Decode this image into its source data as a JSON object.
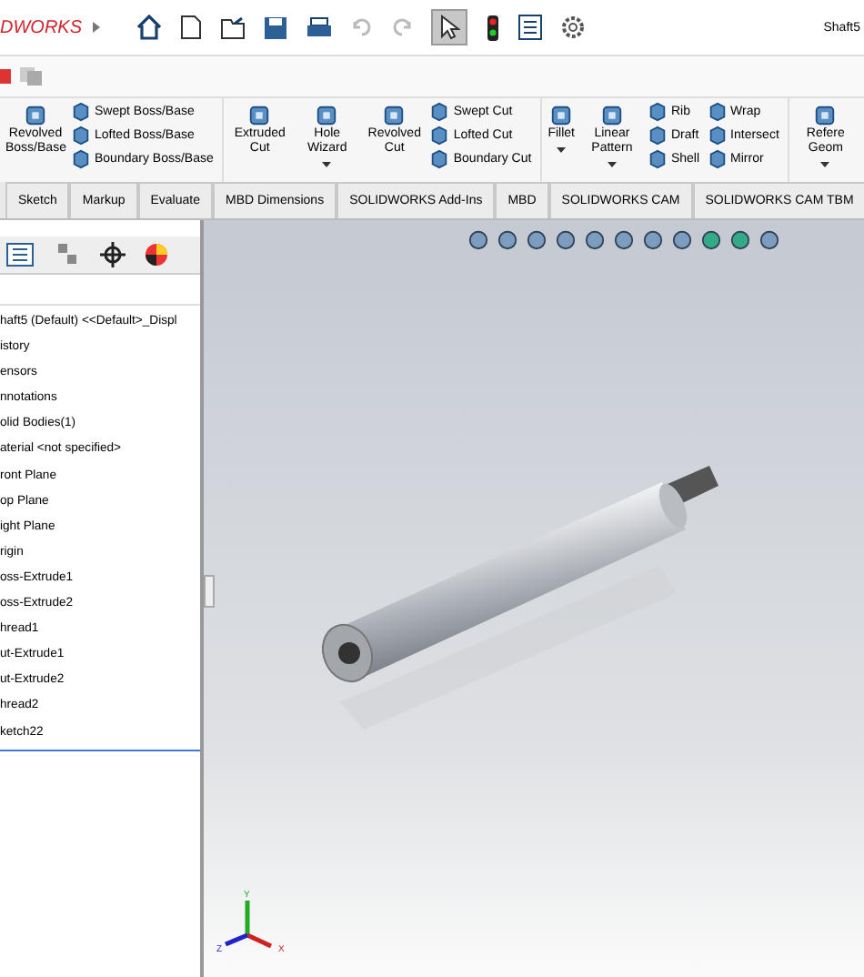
{
  "app": {
    "logo": "DWORKS",
    "document": "Shaft5"
  },
  "ribbon": [
    {
      "items": [
        {
          "kind": "large",
          "label": "Revolved Boss/Base",
          "dropdown": false
        },
        {
          "kind": "column",
          "labels": [
            "Swept Boss/Base",
            "Lofted Boss/Base",
            "Boundary Boss/Base"
          ]
        }
      ]
    },
    {
      "items": [
        {
          "kind": "large",
          "label": "Extruded Cut",
          "dropdown": false
        },
        {
          "kind": "large",
          "label": "Hole Wizard",
          "dropdown": true
        },
        {
          "kind": "large",
          "label": "Revolved Cut",
          "dropdown": false
        },
        {
          "kind": "column",
          "labels": [
            "Swept Cut",
            "Lofted Cut",
            "Boundary Cut"
          ]
        }
      ]
    },
    {
      "items": [
        {
          "kind": "large",
          "label": "Fillet",
          "dropdown": true
        },
        {
          "kind": "large",
          "label": "Linear Pattern",
          "dropdown": true
        },
        {
          "kind": "column",
          "labels": [
            "Rib",
            "Draft",
            "Shell"
          ]
        },
        {
          "kind": "column",
          "labels": [
            "Wrap",
            "Intersect",
            "Mirror"
          ]
        }
      ]
    },
    {
      "items": [
        {
          "kind": "large",
          "label": "Refere Geom",
          "dropdown": true
        }
      ]
    }
  ],
  "tabs": [
    {
      "label": "Sketch",
      "selected": false
    },
    {
      "label": "Markup",
      "selected": false
    },
    {
      "label": "Evaluate",
      "selected": false
    },
    {
      "label": "MBD Dimensions",
      "selected": false
    },
    {
      "label": "SOLIDWORKS Add-Ins",
      "selected": false
    },
    {
      "label": "MBD",
      "selected": false
    },
    {
      "label": "SOLIDWORKS CAM",
      "selected": false
    },
    {
      "label": "SOLIDWORKS CAM TBM",
      "selected": false
    }
  ],
  "tree": [
    "haft5 (Default) <<Default>_Displ",
    "istory",
    "ensors",
    "nnotations",
    "olid Bodies(1)",
    "aterial <not specified>",
    "ront Plane",
    "op Plane",
    "ight Plane",
    "rigin",
    "oss-Extrude1",
    "oss-Extrude2",
    "hread1",
    "ut-Extrude1",
    "ut-Extrude2",
    "hread2",
    "ketch22"
  ],
  "triad": {
    "x": "X",
    "y": "Y",
    "z": "Z"
  }
}
